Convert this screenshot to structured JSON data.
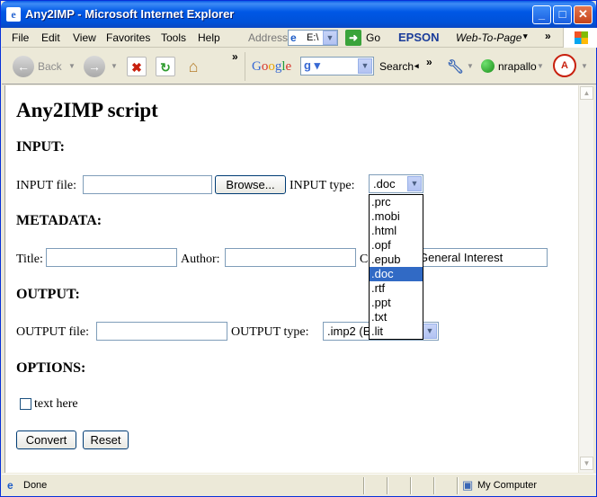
{
  "window": {
    "title": "Any2IMP - Microsoft Internet Explorer"
  },
  "menubar": {
    "items": [
      "File",
      "Edit",
      "View",
      "Favorites",
      "Tools",
      "Help"
    ],
    "address_label": "Address",
    "address_value": "E:\\",
    "go_label": "Go",
    "epson_label": "EPSON",
    "web_to_page_label": "Web-To-Page"
  },
  "toolbar": {
    "back_label": "Back",
    "search_label": "Search",
    "user_label": "nrapallo"
  },
  "page": {
    "heading": "Any2IMP script",
    "input_section": "INPUT:",
    "input_file_label": "INPUT file:",
    "browse_label": "Browse...",
    "input_type_label": "INPUT type:",
    "input_type_value": ".doc",
    "input_type_options": [
      ".prc",
      ".mobi",
      ".html",
      ".opf",
      ".epub",
      ".doc",
      ".rtf",
      ".ppt",
      ".txt",
      ".lit"
    ],
    "input_type_selected_index": 5,
    "metadata_section": "METADATA:",
    "title_label": "Title:",
    "author_label": "Author:",
    "category_label_visible": "C",
    "category_value": "General Interest",
    "output_section": "OUTPUT:",
    "output_file_label": "OUTPUT file:",
    "output_type_label": "OUTPUT type:",
    "output_type_value": ".imp2 (E",
    "options_section": "OPTIONS:",
    "checkbox_label": "text here",
    "convert_label": "Convert",
    "reset_label": "Reset"
  },
  "status": {
    "left_text": "Done",
    "zone_text": "My Computer"
  }
}
